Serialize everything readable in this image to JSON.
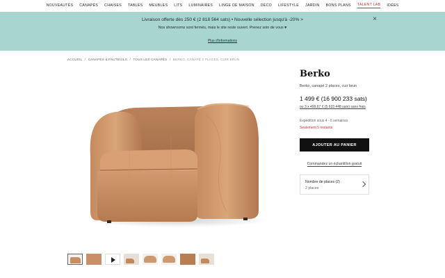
{
  "nav": {
    "items": [
      "Nouveautés",
      "Canapés",
      "Chaises",
      "Tables",
      "Meubles",
      "Lits",
      "Luminaires",
      "Linge de maison",
      "Déco",
      "Lifestyle",
      "Jardin",
      "Bons plans",
      "Talent Lab",
      "Idées"
    ]
  },
  "banner": {
    "line1": "Livraison offerte dès 250 € (2 818 564 sats) • Nouvelle sélection jusqu'à -20% >",
    "line2": "Nos showrooms sont fermés, mais le site reste ouvert. Prenez soin de vous ♥",
    "more_link": "Plus d'informations",
    "close_label": "×"
  },
  "breadcrumb": {
    "items": [
      "Accueil",
      "Canapés & fauteuils",
      "Tous les canapés"
    ],
    "separator": "/",
    "current": "Berko, canapé 2 places, cuir brun"
  },
  "product": {
    "name": "Berko",
    "subtitle": "Berko, canapé 2 places, cuir brun",
    "price": "1 499 € (16 900 233 sats)",
    "installments": "ou 3 x 499,67 € (5 633 448 sats) sans frais",
    "shipping": "Expédition sous 4 - 6 semaines",
    "stock": "Seulement 5 restants",
    "add_to_cart": "Ajouter au panier",
    "sample_link": "Commandez un échantillon gratuit",
    "option_label": "Nombre de places (2)",
    "option_value": "2 places",
    "colors": {
      "leather": "#c68d63",
      "accent_red": "#c5302d",
      "banner_bg": "#a8d5d0"
    }
  }
}
